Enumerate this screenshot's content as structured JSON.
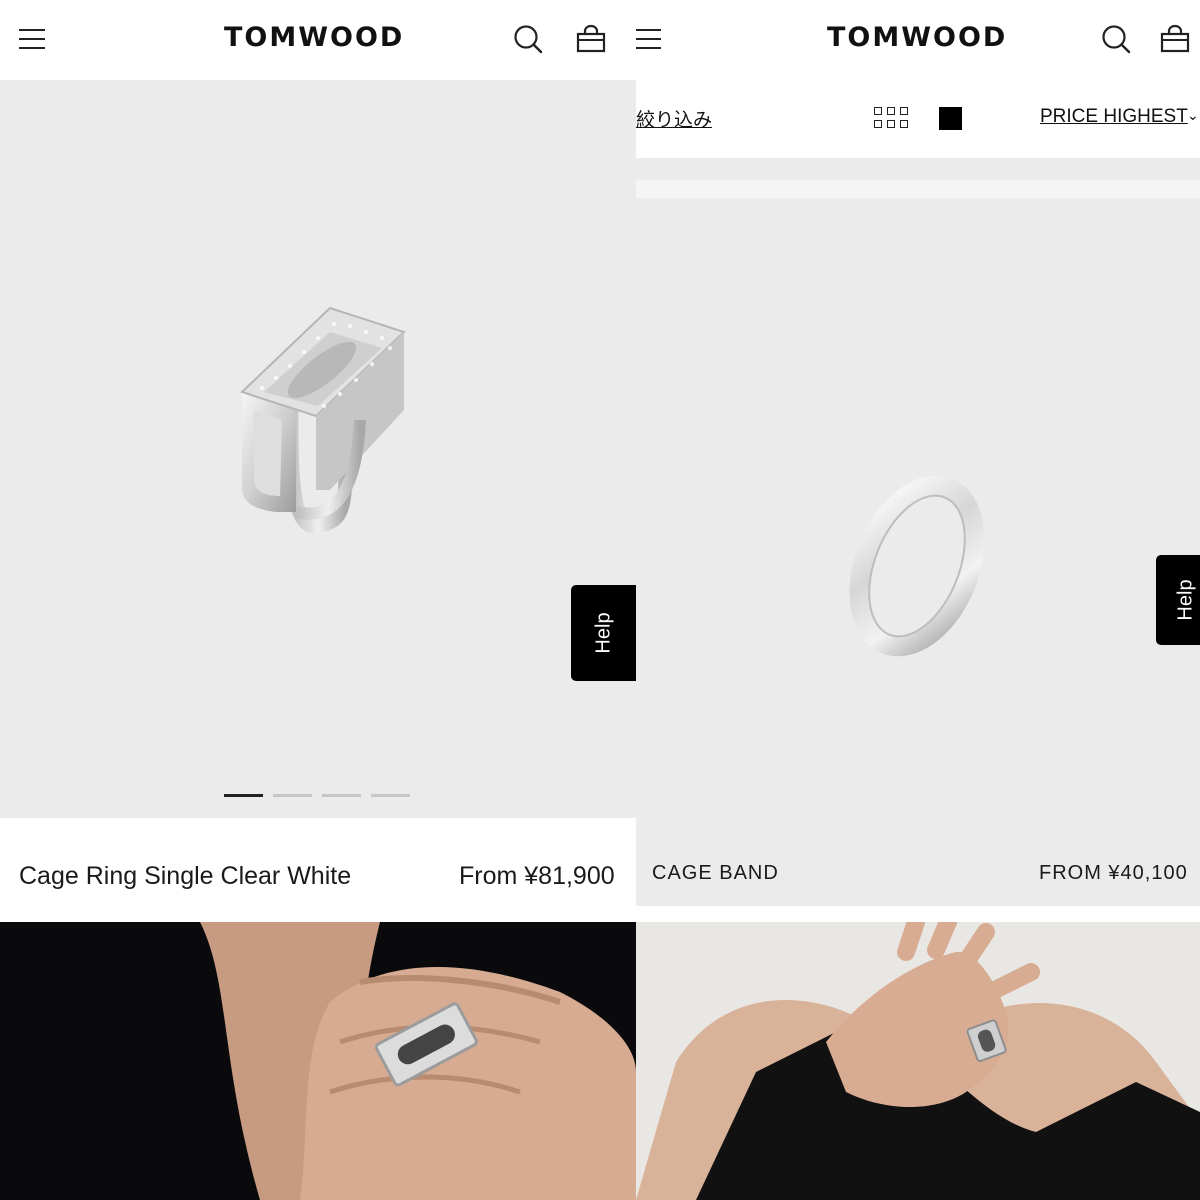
{
  "brand": "TOMWOOD",
  "help_label": "Help",
  "left": {
    "product_name": "Cage Ring Single Clear White",
    "product_price": "From ¥81,900",
    "carousel_count": 4,
    "carousel_active": 1
  },
  "right": {
    "filter_label": "絞り込み",
    "sort_label": "PRICE HIGHEST",
    "product_name": "CAGE BAND",
    "product_price": "FROM ¥40,100"
  },
  "colors": {
    "image_bg": "#ebebeb",
    "text": "#111111",
    "help_bg": "#000000"
  },
  "icons": [
    "menu-icon",
    "search-icon",
    "bag-icon",
    "grid-view-icon",
    "single-view-icon",
    "chevron-down-icon"
  ]
}
